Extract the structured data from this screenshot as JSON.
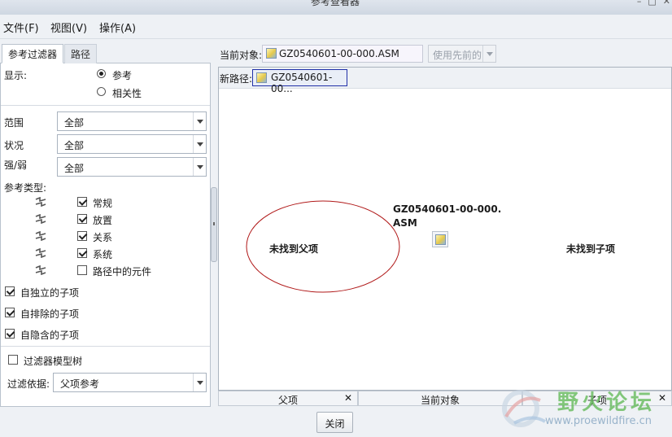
{
  "window": {
    "title": "参考查看器"
  },
  "menu": [
    "文件(F)",
    "视图(V)",
    "操作(A)"
  ],
  "tabs": {
    "filter": "参考过滤器",
    "path": "路径"
  },
  "display": {
    "label": "显示:",
    "options": [
      {
        "label": "参考",
        "selected": true
      },
      {
        "label": "相关性",
        "selected": false
      }
    ]
  },
  "filters": [
    {
      "label": "范围",
      "value": "全部"
    },
    {
      "label": "状况",
      "value": "全部"
    },
    {
      "label": "强/弱",
      "value": "全部"
    }
  ],
  "ref_types": {
    "label": "参考类型:",
    "items": [
      {
        "label": "常规",
        "checked": true
      },
      {
        "label": "放置",
        "checked": true
      },
      {
        "label": "关系",
        "checked": true
      },
      {
        "label": "系统",
        "checked": true
      },
      {
        "label": "路径中的元件",
        "checked": false
      }
    ]
  },
  "auto_options": [
    {
      "label": "自独立的子项",
      "checked": true
    },
    {
      "label": "自排除的子项",
      "checked": true
    },
    {
      "label": "自隐含的子项",
      "checked": true
    }
  ],
  "filter_model_tree": {
    "label": "过滤器模型树",
    "checked": false
  },
  "filter_basis": {
    "label": "过滤依据:",
    "value": "父项参考"
  },
  "current_object": {
    "label": "当前对象:",
    "value": "GZ0540601-00-000.ASM",
    "use_previous": "使用先前的"
  },
  "new_path": {
    "label": "新路径:",
    "value": "GZ0540601-00..."
  },
  "graph": {
    "parent_label": "未找到父项",
    "node_label_line1": "GZ0540601-00-000.",
    "node_label_line2": "ASM",
    "child_label": "未找到子项",
    "ellipse_color": "#b01818"
  },
  "bottom_tabs": [
    {
      "label": "父项",
      "close": "✕"
    },
    {
      "label": "当前对象"
    },
    {
      "label": "子项",
      "close": "✕"
    }
  ],
  "close_button": "关闭",
  "watermark": {
    "name": "野火论坛",
    "url": "www.proewildfire.cn"
  }
}
